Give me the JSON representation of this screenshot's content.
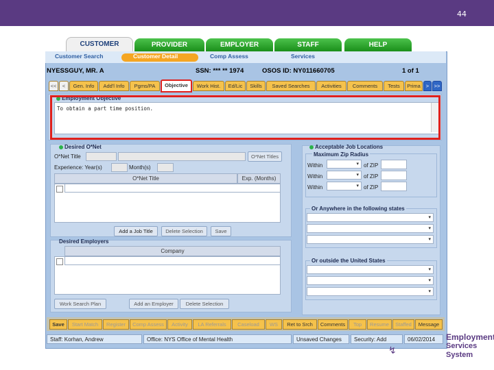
{
  "slide": {
    "page_number": "44"
  },
  "top_tabs": [
    "CUSTOMER",
    "PROVIDER",
    "EMPLOYER",
    "STAFF",
    "HELP"
  ],
  "sub_nav": {
    "items": [
      "Customer Search",
      "Customer Detail",
      "Comp Assess",
      "Services"
    ]
  },
  "customer": {
    "name": "NYESSGUY, MR. A",
    "ssn": "SSN: *** ** 1974",
    "osos": "OSOS ID: NY011660705",
    "page": "1 of 1"
  },
  "detail_tabs": [
    "<<",
    "<",
    "Gen. Info",
    "Add'l Info",
    "Pgms/PA",
    "Objective",
    "Work Hist.",
    "Ed/Lic",
    "Skills",
    "Saved Searches",
    "Activities",
    "Comments",
    "Tests",
    "Prima",
    ">",
    ">>"
  ],
  "objective": {
    "title": "Employment Objective",
    "text": "To obtain a part time position."
  },
  "onet": {
    "title": "Desired O*Net",
    "title_label": "O*Net Title",
    "onet_button": "O*Net Titles",
    "experience_label": "Experience: Year(s)",
    "months_label": "Month(s)",
    "col_title": "O*Net Title",
    "col_exp": "Exp. (Months)",
    "add_button": "Add a Job Title",
    "delete_button": "Delete Selection",
    "save_button": "Save"
  },
  "employers": {
    "title": "Desired Employers",
    "col_company": "Company",
    "search_button": "Work Search Plan",
    "add_button": "Add an Employer",
    "delete_button": "Delete Selection"
  },
  "locations": {
    "title": "Acceptable Job Locations",
    "radius_title": "Maximum Zip Radius",
    "within": "Within",
    "of_zip": "of ZIP",
    "of_zip2": "of ZIP",
    "anywhere_title": "Or Anywhere in the following states",
    "outside_title": "Or outside the United States"
  },
  "bottom_tabs": [
    "Save",
    "Start Match",
    "Register",
    "Comp Assess",
    "Activity",
    "LA Referrals",
    "Caseload",
    "WS",
    "Ret to Srch",
    "Comments",
    "Top",
    "Resume",
    "Staffed",
    "Message"
  ],
  "status": {
    "staff": "Staff: Korhan, Andrew",
    "office": "Office: NYS Office of Mental Health",
    "changes": "Unsaved Changes",
    "security": "Security: Add",
    "date": "06/02/2014"
  },
  "logo": {
    "line1": "Employment",
    "line2": "Services System"
  }
}
